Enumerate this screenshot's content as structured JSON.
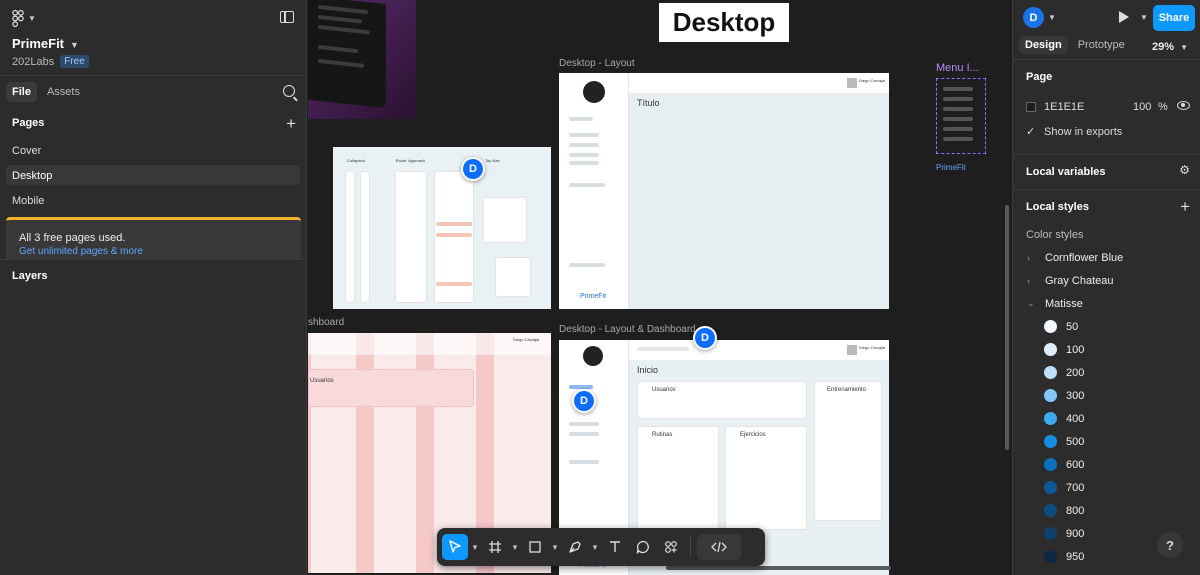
{
  "file": {
    "project_name": "PrimeFit",
    "team_name": "202Labs",
    "plan_badge": "Free"
  },
  "left_tabs": [
    "File",
    "Assets"
  ],
  "pages": {
    "header": "Pages",
    "items": [
      "Cover",
      "Desktop",
      "Mobile"
    ],
    "active": "Desktop"
  },
  "notice": {
    "text": "All 3 free pages used.",
    "link": "Get unlimited pages & more"
  },
  "layers_header": "Layers",
  "canvas": {
    "section_title": "Desktop",
    "frame_labels": {
      "layout": "Desktop - Layout",
      "layout_dashboard": "Desktop - Layout & Dashboard",
      "dashboard_partial": "shboard",
      "menu": "Menu I..."
    },
    "layout_heading": "Título",
    "dashboard_heading": "Inicio",
    "dashboard_cards": [
      "Usuarios",
      "Entrenamiento",
      "Rutinas",
      "Ejercicios"
    ],
    "partial_dashboard_card": "Usuarios",
    "approaches": [
      "Collapsed",
      "'Route' Approach",
      "Top Nav"
    ],
    "brand_footer": "PrimeFit",
    "user_name": "Diego Carvajal",
    "cursor_initial": "D"
  },
  "toolbar": {
    "tools": [
      "move-tool",
      "frame-tool",
      "shape-tool",
      "pen-tool",
      "text-tool",
      "comment-tool",
      "actions-tool",
      "dev-mode-toggle"
    ]
  },
  "right": {
    "avatar_initial": "D",
    "share_label": "Share",
    "tabs": [
      "Design",
      "Prototype"
    ],
    "zoom": "29%",
    "page_section": "Page",
    "page_color": "1E1E1E",
    "page_opacity": "100",
    "percent": "%",
    "show_in_exports": "Show in exports",
    "local_variables": "Local variables",
    "local_styles": "Local styles",
    "color_styles": "Color styles",
    "groups": [
      "Cornflower Blue",
      "Gray Chateau",
      "Matisse"
    ],
    "shades": [
      {
        "label": "50",
        "color": "#f1f8fe"
      },
      {
        "label": "100",
        "color": "#e1effd"
      },
      {
        "label": "200",
        "color": "#bde0fa"
      },
      {
        "label": "300",
        "color": "#82c6f7"
      },
      {
        "label": "400",
        "color": "#3fa9f1"
      },
      {
        "label": "500",
        "color": "#168ee0"
      },
      {
        "label": "600",
        "color": "#0a70bf"
      },
      {
        "label": "700",
        "color": "#0a5a9a"
      },
      {
        "label": "800",
        "color": "#0d4c7f"
      },
      {
        "label": "900",
        "color": "#11416a"
      },
      {
        "label": "950",
        "color": "#0b2947"
      }
    ],
    "help": "?"
  }
}
